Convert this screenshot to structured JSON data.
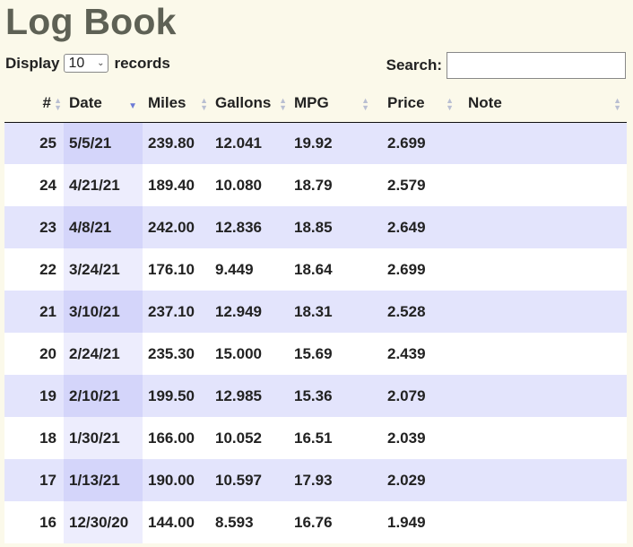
{
  "page": {
    "title": "Log Book"
  },
  "controls": {
    "display_label": "Display",
    "records_label": "records",
    "page_length_value": "10",
    "search_label": "Search:",
    "search_value": ""
  },
  "table": {
    "columns": [
      {
        "label": "#"
      },
      {
        "label": "Date"
      },
      {
        "label": "Miles"
      },
      {
        "label": "Gallons"
      },
      {
        "label": "MPG"
      },
      {
        "label": "Price"
      },
      {
        "label": "Note"
      }
    ],
    "rows": [
      {
        "num": "25",
        "date": "5/5/21",
        "miles": "239.80",
        "gallons": "12.041",
        "mpg": "19.92",
        "price": "2.699",
        "note": ""
      },
      {
        "num": "24",
        "date": "4/21/21",
        "miles": "189.40",
        "gallons": "10.080",
        "mpg": "18.79",
        "price": "2.579",
        "note": ""
      },
      {
        "num": "23",
        "date": "4/8/21",
        "miles": "242.00",
        "gallons": "12.836",
        "mpg": "18.85",
        "price": "2.649",
        "note": ""
      },
      {
        "num": "22",
        "date": "3/24/21",
        "miles": "176.10",
        "gallons": "9.449",
        "mpg": "18.64",
        "price": "2.699",
        "note": ""
      },
      {
        "num": "21",
        "date": "3/10/21",
        "miles": "237.10",
        "gallons": "12.949",
        "mpg": "18.31",
        "price": "2.528",
        "note": ""
      },
      {
        "num": "20",
        "date": "2/24/21",
        "miles": "235.30",
        "gallons": "15.000",
        "mpg": "15.69",
        "price": "2.439",
        "note": ""
      },
      {
        "num": "19",
        "date": "2/10/21",
        "miles": "199.50",
        "gallons": "12.985",
        "mpg": "15.36",
        "price": "2.079",
        "note": ""
      },
      {
        "num": "18",
        "date": "1/30/21",
        "miles": "166.00",
        "gallons": "10.052",
        "mpg": "16.51",
        "price": "2.039",
        "note": ""
      },
      {
        "num": "17",
        "date": "1/13/21",
        "miles": "190.00",
        "gallons": "10.597",
        "mpg": "17.93",
        "price": "2.029",
        "note": ""
      },
      {
        "num": "16",
        "date": "12/30/20",
        "miles": "144.00",
        "gallons": "8.593",
        "mpg": "16.76",
        "price": "1.949",
        "note": ""
      }
    ]
  },
  "colors": {
    "page_background": "#fbf9ea",
    "title": "#5e6155",
    "odd_row": "#e3e4fc",
    "odd_row_sorted": "#d4d5fa",
    "even_row_sorted": "#ededfd",
    "active_sort_arrow": "#6c7bd6"
  }
}
